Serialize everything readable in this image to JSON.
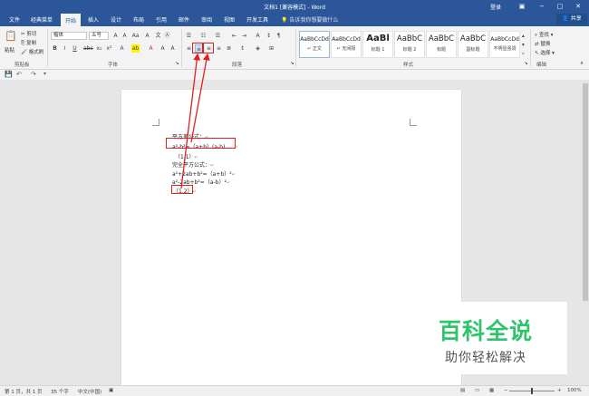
{
  "titlebar": {
    "title": "文档1 [兼容模式] - Word",
    "login": "登录",
    "restore_icon": "ribbon-display-icon",
    "minimize": "−",
    "maximize": "□",
    "close": "✕"
  },
  "tabs": [
    "文件",
    "经典菜单",
    "开始",
    "插入",
    "设计",
    "布局",
    "引用",
    "邮件",
    "审阅",
    "视图",
    "开发工具"
  ],
  "active_tab": "开始",
  "tellme": "告诉我你想要做什么",
  "share": "共享",
  "clipboard": {
    "paste": "粘贴",
    "cut": "剪切",
    "copy": "复制",
    "format_painter": "格式刷",
    "label": "剪贴板"
  },
  "font": {
    "name": "楷体",
    "size": "五号",
    "label": "字体"
  },
  "paragraph": {
    "label": "段落"
  },
  "styles": {
    "label": "样式",
    "items": [
      {
        "sample": "AaBbCcDd",
        "name": "↵ 正文"
      },
      {
        "sample": "AaBbCcDd",
        "name": "↵ 无间隔"
      },
      {
        "sample": "AaBl",
        "name": "标题 1"
      },
      {
        "sample": "AaBbC",
        "name": "标题 2"
      },
      {
        "sample": "AaBbC",
        "name": "标题"
      },
      {
        "sample": "AaBbC",
        "name": "副标题"
      },
      {
        "sample": "AaBbCcDd",
        "name": "不明显强调"
      }
    ]
  },
  "editing": {
    "find": "查找",
    "replace": "替换",
    "select": "选择",
    "label": "编辑"
  },
  "document": {
    "lines": [
      "平方差公式：",
      "a²-b²=（a+b）(a-b)",
      "（1.1）",
      "完全平方公式：",
      "a²+2ab+b²=（a+b）²",
      "a²-2ab+b²=（a-b）²",
      "（1.2）"
    ]
  },
  "watermark": {
    "main": "百科全说",
    "sub": "助你轻松解决"
  },
  "status": {
    "page": "第 1 页，共 1 页",
    "words": "35 个字",
    "lang": "中文(中国)",
    "zoom": "100%",
    "zoom_minus": "−",
    "zoom_plus": "+"
  },
  "colors": {
    "brand": "#2b579a",
    "annotation": "#e02020",
    "watermark": "#30c46a"
  }
}
